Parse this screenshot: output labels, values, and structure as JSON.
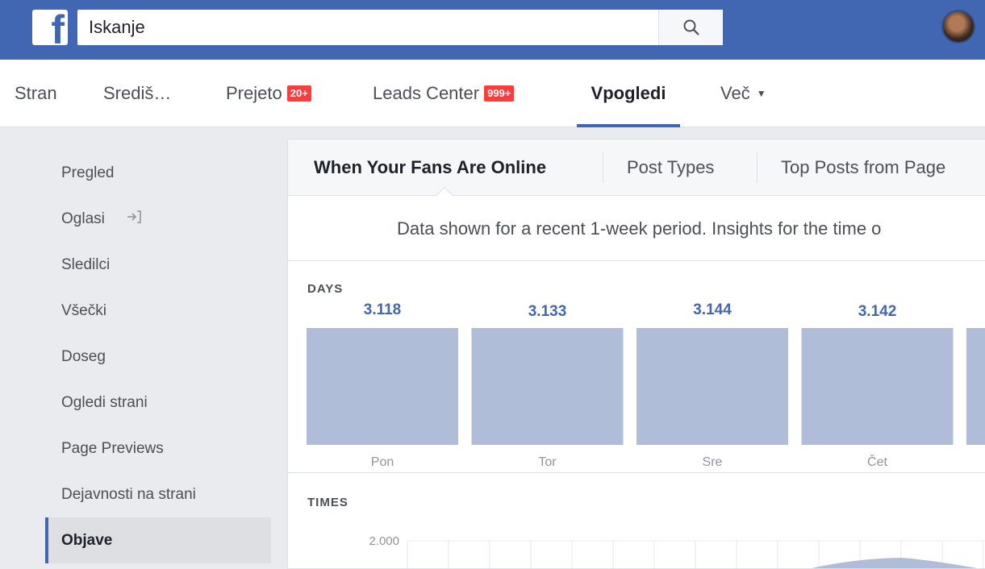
{
  "header": {
    "logo": "f",
    "search_placeholder": "Iskanje",
    "icons": {
      "search": "search-icon",
      "avatar": "profile-avatar"
    }
  },
  "page_nav": {
    "tabs": [
      {
        "label": "Stran",
        "badge": ""
      },
      {
        "label": "Središ…",
        "badge": ""
      },
      {
        "label": "Prejeto",
        "badge": "20+"
      },
      {
        "label": "Leads Center",
        "badge": "999+"
      },
      {
        "label": "Vpogledi",
        "badge": "",
        "active": true
      },
      {
        "label": "Več",
        "badge": ""
      }
    ]
  },
  "sidebar": {
    "items": [
      {
        "label": "Pregled"
      },
      {
        "label": "Oglasi",
        "icon": "login-arrow-icon"
      },
      {
        "label": "Sledilci"
      },
      {
        "label": "Všečki"
      },
      {
        "label": "Doseg"
      },
      {
        "label": "Ogledi strani"
      },
      {
        "label": "Page Previews"
      },
      {
        "label": "Dejavnosti na strani"
      },
      {
        "label": "Objave",
        "active": true
      }
    ]
  },
  "main": {
    "subtabs": [
      {
        "label": "When Your Fans Are Online",
        "active": true
      },
      {
        "label": "Post Types"
      },
      {
        "label": "Top Posts from Page"
      }
    ],
    "notice": "Data shown for a recent 1-week period. Insights for the time o",
    "days_label": "DAYS",
    "times_label": "TIMES"
  },
  "colors": {
    "brand": "#4267b2",
    "bar": "#afbdd9",
    "value_text": "#4267b2"
  },
  "chart_data": [
    {
      "type": "bar",
      "title": "DAYS",
      "categories": [
        "Pon",
        "Tor",
        "Sre",
        "Čet"
      ],
      "values": [
        3118,
        3133,
        3144,
        3142
      ],
      "value_labels": [
        "3.118",
        "3.133",
        "3.144",
        "3.142"
      ]
    },
    {
      "type": "area",
      "title": "TIMES",
      "y_tick_labels": [
        "2.000"
      ]
    }
  ]
}
